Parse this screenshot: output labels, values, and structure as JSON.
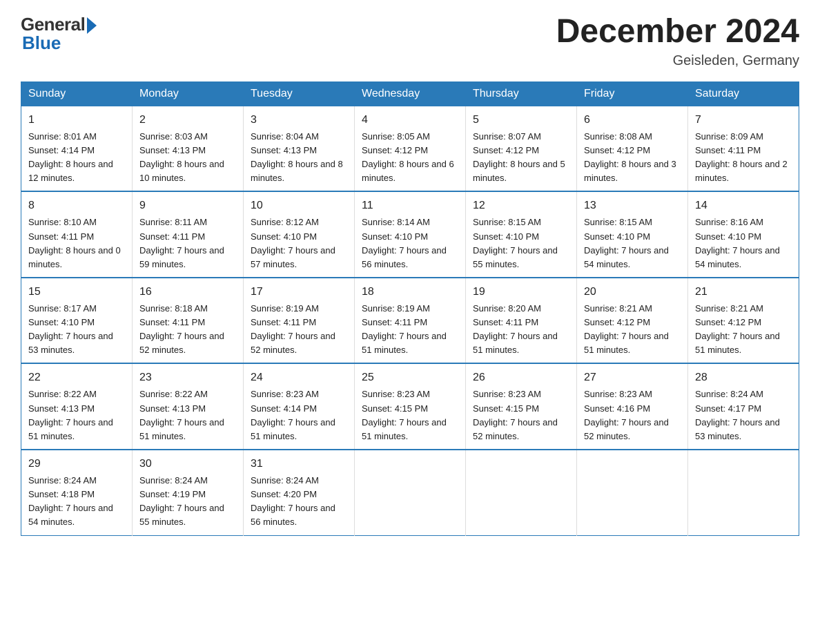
{
  "header": {
    "logo_general": "General",
    "logo_blue": "Blue",
    "month_title": "December 2024",
    "location": "Geisleden, Germany"
  },
  "weekdays": [
    "Sunday",
    "Monday",
    "Tuesday",
    "Wednesday",
    "Thursday",
    "Friday",
    "Saturday"
  ],
  "weeks": [
    [
      {
        "day": "1",
        "sunrise": "8:01 AM",
        "sunset": "4:14 PM",
        "daylight": "8 hours and 12 minutes."
      },
      {
        "day": "2",
        "sunrise": "8:03 AM",
        "sunset": "4:13 PM",
        "daylight": "8 hours and 10 minutes."
      },
      {
        "day": "3",
        "sunrise": "8:04 AM",
        "sunset": "4:13 PM",
        "daylight": "8 hours and 8 minutes."
      },
      {
        "day": "4",
        "sunrise": "8:05 AM",
        "sunset": "4:12 PM",
        "daylight": "8 hours and 6 minutes."
      },
      {
        "day": "5",
        "sunrise": "8:07 AM",
        "sunset": "4:12 PM",
        "daylight": "8 hours and 5 minutes."
      },
      {
        "day": "6",
        "sunrise": "8:08 AM",
        "sunset": "4:12 PM",
        "daylight": "8 hours and 3 minutes."
      },
      {
        "day": "7",
        "sunrise": "8:09 AM",
        "sunset": "4:11 PM",
        "daylight": "8 hours and 2 minutes."
      }
    ],
    [
      {
        "day": "8",
        "sunrise": "8:10 AM",
        "sunset": "4:11 PM",
        "daylight": "8 hours and 0 minutes."
      },
      {
        "day": "9",
        "sunrise": "8:11 AM",
        "sunset": "4:11 PM",
        "daylight": "7 hours and 59 minutes."
      },
      {
        "day": "10",
        "sunrise": "8:12 AM",
        "sunset": "4:10 PM",
        "daylight": "7 hours and 57 minutes."
      },
      {
        "day": "11",
        "sunrise": "8:14 AM",
        "sunset": "4:10 PM",
        "daylight": "7 hours and 56 minutes."
      },
      {
        "day": "12",
        "sunrise": "8:15 AM",
        "sunset": "4:10 PM",
        "daylight": "7 hours and 55 minutes."
      },
      {
        "day": "13",
        "sunrise": "8:15 AM",
        "sunset": "4:10 PM",
        "daylight": "7 hours and 54 minutes."
      },
      {
        "day": "14",
        "sunrise": "8:16 AM",
        "sunset": "4:10 PM",
        "daylight": "7 hours and 54 minutes."
      }
    ],
    [
      {
        "day": "15",
        "sunrise": "8:17 AM",
        "sunset": "4:10 PM",
        "daylight": "7 hours and 53 minutes."
      },
      {
        "day": "16",
        "sunrise": "8:18 AM",
        "sunset": "4:11 PM",
        "daylight": "7 hours and 52 minutes."
      },
      {
        "day": "17",
        "sunrise": "8:19 AM",
        "sunset": "4:11 PM",
        "daylight": "7 hours and 52 minutes."
      },
      {
        "day": "18",
        "sunrise": "8:19 AM",
        "sunset": "4:11 PM",
        "daylight": "7 hours and 51 minutes."
      },
      {
        "day": "19",
        "sunrise": "8:20 AM",
        "sunset": "4:11 PM",
        "daylight": "7 hours and 51 minutes."
      },
      {
        "day": "20",
        "sunrise": "8:21 AM",
        "sunset": "4:12 PM",
        "daylight": "7 hours and 51 minutes."
      },
      {
        "day": "21",
        "sunrise": "8:21 AM",
        "sunset": "4:12 PM",
        "daylight": "7 hours and 51 minutes."
      }
    ],
    [
      {
        "day": "22",
        "sunrise": "8:22 AM",
        "sunset": "4:13 PM",
        "daylight": "7 hours and 51 minutes."
      },
      {
        "day": "23",
        "sunrise": "8:22 AM",
        "sunset": "4:13 PM",
        "daylight": "7 hours and 51 minutes."
      },
      {
        "day": "24",
        "sunrise": "8:23 AM",
        "sunset": "4:14 PM",
        "daylight": "7 hours and 51 minutes."
      },
      {
        "day": "25",
        "sunrise": "8:23 AM",
        "sunset": "4:15 PM",
        "daylight": "7 hours and 51 minutes."
      },
      {
        "day": "26",
        "sunrise": "8:23 AM",
        "sunset": "4:15 PM",
        "daylight": "7 hours and 52 minutes."
      },
      {
        "day": "27",
        "sunrise": "8:23 AM",
        "sunset": "4:16 PM",
        "daylight": "7 hours and 52 minutes."
      },
      {
        "day": "28",
        "sunrise": "8:24 AM",
        "sunset": "4:17 PM",
        "daylight": "7 hours and 53 minutes."
      }
    ],
    [
      {
        "day": "29",
        "sunrise": "8:24 AM",
        "sunset": "4:18 PM",
        "daylight": "7 hours and 54 minutes."
      },
      {
        "day": "30",
        "sunrise": "8:24 AM",
        "sunset": "4:19 PM",
        "daylight": "7 hours and 55 minutes."
      },
      {
        "day": "31",
        "sunrise": "8:24 AM",
        "sunset": "4:20 PM",
        "daylight": "7 hours and 56 minutes."
      },
      null,
      null,
      null,
      null
    ]
  ]
}
